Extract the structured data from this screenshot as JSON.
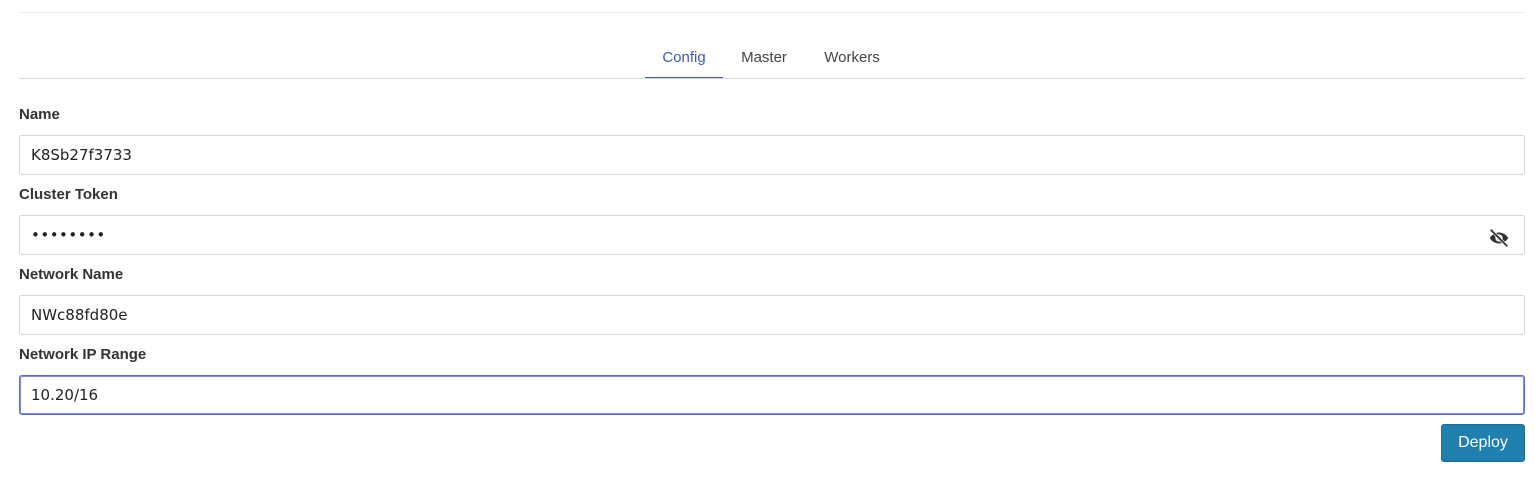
{
  "tabs": [
    {
      "label": "Config",
      "active": true
    },
    {
      "label": "Master",
      "active": false
    },
    {
      "label": "Workers",
      "active": false
    }
  ],
  "form": {
    "name": {
      "label": "Name",
      "value": "K8Sb27f3733"
    },
    "cluster_token": {
      "label": "Cluster Token",
      "value": "••••••••",
      "icon": "eye-off-icon"
    },
    "network_name": {
      "label": "Network Name",
      "value": "NWc88fd80e"
    },
    "network_ip_range": {
      "label": "Network IP Range",
      "value": "10.20/16"
    }
  },
  "actions": {
    "deploy_label": "Deploy"
  },
  "colors": {
    "accent": "#3f5bb5",
    "button": "#1f7fae",
    "focus_border": "#5a6fd6"
  }
}
